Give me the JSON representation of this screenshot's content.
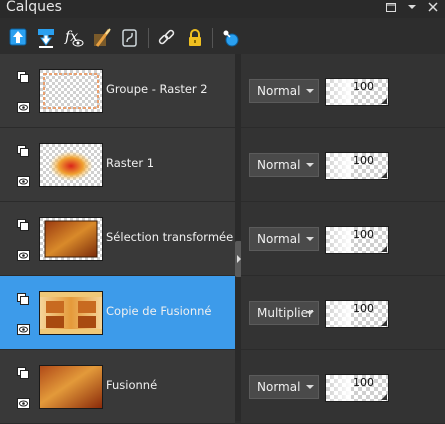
{
  "panel": {
    "title": "Calques"
  },
  "window_icons": [
    "restore-icon",
    "dropdown-icon",
    "close-icon"
  ],
  "toolbar": {
    "buttons": [
      "new-raster-layer-icon",
      "merge-down-icon",
      "layer-visibility-icon",
      "mask-tool-icon",
      "layer-effects-icon",
      "link-layers-icon",
      "lock-transparency-icon",
      "new-vector-layer-icon"
    ]
  },
  "layers": [
    {
      "name": "Groupe - Raster 2",
      "blend": "Normal",
      "opacity": "100",
      "selected": false
    },
    {
      "name": "Raster 1",
      "blend": "Normal",
      "opacity": "100",
      "selected": false
    },
    {
      "name": "Sélection transformée",
      "blend": "Normal",
      "opacity": "100",
      "selected": false
    },
    {
      "name": "Copie de Fusionné",
      "blend": "Multiplier",
      "opacity": "100",
      "selected": true
    },
    {
      "name": "Fusionné",
      "blend": "Normal",
      "opacity": "100",
      "selected": false
    }
  ],
  "colors": {
    "selection": "#3d9bea",
    "accent_blue": "#2aa0f0",
    "lock_yellow": "#f0c020"
  }
}
